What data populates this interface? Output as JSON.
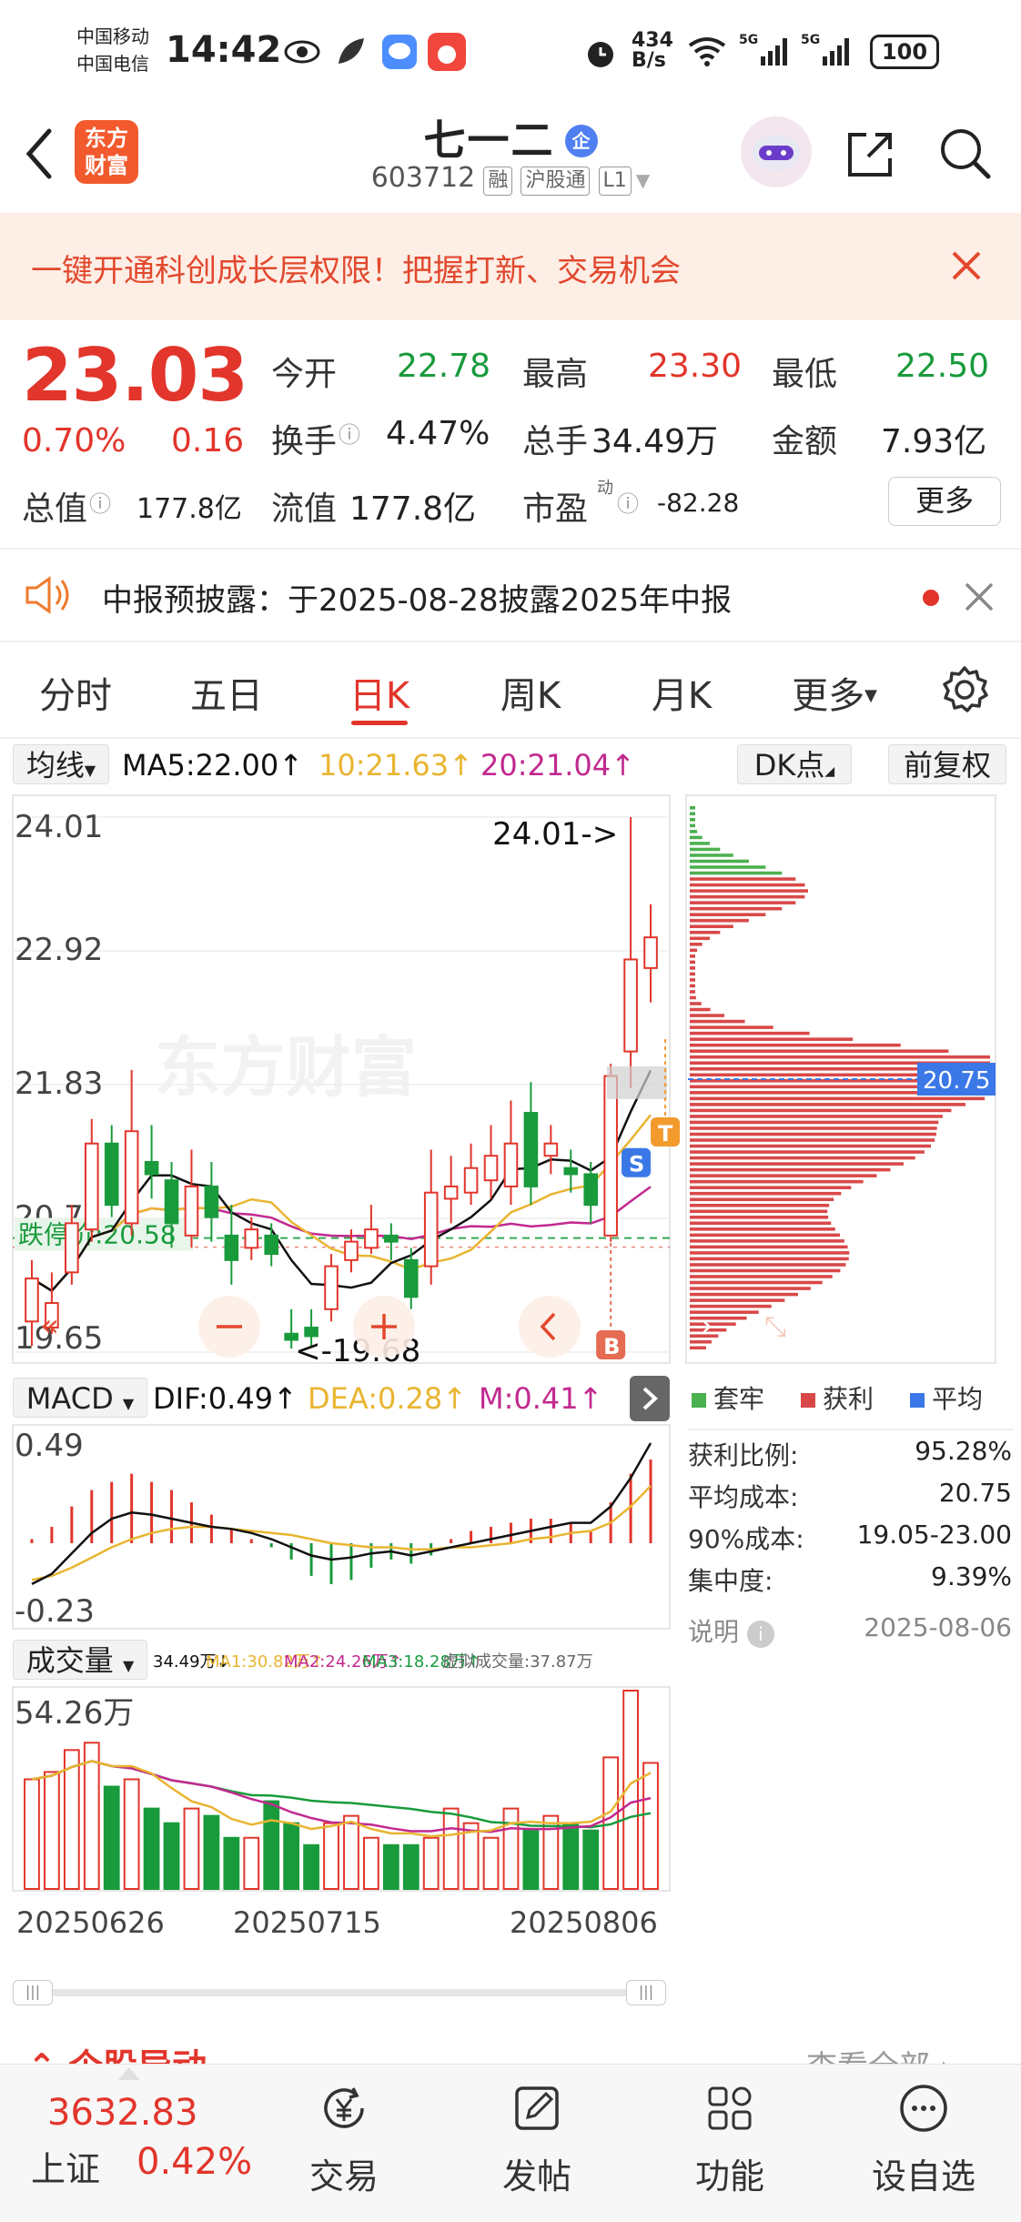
{
  "status_bar": {
    "carrier1": "中国移动",
    "carrier2": "中国电信",
    "time": "14:42",
    "net_speed": "434",
    "net_unit": "B/s",
    "battery": "100"
  },
  "header": {
    "title": "七一二",
    "badge": "企",
    "code": "603712",
    "tags": [
      "融",
      "沪股通",
      "L1"
    ],
    "logo_line1": "东方",
    "logo_line2": "财富"
  },
  "banner": {
    "text": "一键开通科创成长层权限！把握打新、交易机会"
  },
  "quote": {
    "price": "23.03",
    "change_pct": "0.70%",
    "change": "0.16",
    "open_label": "今开",
    "open": "22.78",
    "high_label": "最高",
    "high": "23.30",
    "low_label": "最低",
    "low": "22.50",
    "turnover_label": "换手",
    "turnover": "4.47%",
    "volume_label": "总手",
    "volume": "34.49万",
    "amount_label": "金额",
    "amount": "7.93亿",
    "mcap_label": "总值",
    "mcap": "177.8亿",
    "float_label": "流值",
    "float_cap": "177.8亿",
    "pe_label": "市盈",
    "pe_sup": "动",
    "pe": "-82.28",
    "more": "更多"
  },
  "notice": {
    "text": "中报预披露：于2025-08-28披露2025年中报"
  },
  "tabs": {
    "items": [
      "分时",
      "五日",
      "日K",
      "周K",
      "月K",
      "更多"
    ],
    "active": 2
  },
  "chart_controls": {
    "ma_select": "均线",
    "ma5": "MA5:22.00↑",
    "ma10": "10:21.63↑",
    "ma20": "20:21.04↑",
    "dk": "DK点",
    "adjust": "前复权"
  },
  "colors": {
    "up": "#e2352b",
    "down": "#199b3c",
    "ma5": "#111111",
    "ma10": "#e9b531",
    "ma20": "#c2298f",
    "avg": "#3b78e7"
  },
  "kline": {
    "y_labels": [
      "24.01",
      "22.92",
      "21.83",
      "20.74",
      "19.65"
    ],
    "max_marker": "24.01->",
    "min_marker": "<-19.68",
    "limit_down": "跌停价:20.58",
    "watermark": "东方财富",
    "signal_s": "S",
    "signal_t": "T",
    "signal_b": "B"
  },
  "chip": {
    "avg_label": "20.75",
    "legend": [
      "套牢",
      "获利",
      "平均"
    ],
    "stats": [
      {
        "label": "获利比例:",
        "value": "95.28%"
      },
      {
        "label": "平均成本:",
        "value": "20.75"
      },
      {
        "label": "90%成本:",
        "value": "19.05-23.00"
      },
      {
        "label": "集中度:",
        "value": "9.39%"
      }
    ],
    "note": "说明",
    "date": "2025-08-06"
  },
  "macd": {
    "select": "MACD",
    "dif": "DIF:0.49↑",
    "dea": "DEA:0.28↑",
    "m": "M:0.41↑",
    "y_top": "0.49",
    "y_bottom": "-0.23"
  },
  "volume": {
    "select": "成交量",
    "v_now": "34.49万↓",
    "ma1": "MA1:30.82万↑",
    "ma2": "MA2:24.26万↑",
    "ma3": "MA3:18.28万↑",
    "virtual": "虚拟成交量:37.87万",
    "y_top": "54.26万",
    "dates": [
      "20250626",
      "20250715",
      "20250806"
    ]
  },
  "peek": {
    "left": "个股异动",
    "right": "查看全部"
  },
  "bottom_nav": {
    "index_value": "3632.83",
    "index_name": "上证",
    "index_pct": "0.42%",
    "items": [
      "交易",
      "发帖",
      "功能",
      "设自选"
    ]
  },
  "chart_data": [
    {
      "type": "candlestick",
      "title": "日K",
      "ylim": [
        19.65,
        24.01
      ],
      "y_ticks": [
        24.01,
        22.92,
        21.83,
        20.74,
        19.65
      ],
      "candles": [
        {
          "o": 19.9,
          "c": 20.25,
          "h": 20.4,
          "l": 19.7
        },
        {
          "o": 19.85,
          "c": 20.05,
          "h": 20.3,
          "l": 19.8
        },
        {
          "o": 20.3,
          "c": 20.7,
          "h": 20.85,
          "l": 20.2
        },
        {
          "o": 20.65,
          "c": 21.35,
          "h": 21.55,
          "l": 20.55
        },
        {
          "o": 21.35,
          "c": 20.85,
          "h": 21.5,
          "l": 20.75
        },
        {
          "o": 20.7,
          "c": 21.45,
          "h": 21.95,
          "l": 20.6
        },
        {
          "o": 21.2,
          "c": 21.1,
          "h": 21.5,
          "l": 20.9
        },
        {
          "o": 21.05,
          "c": 20.7,
          "h": 21.2,
          "l": 20.5
        },
        {
          "o": 20.6,
          "c": 21.0,
          "h": 21.3,
          "l": 20.5
        },
        {
          "o": 21.0,
          "c": 20.75,
          "h": 21.2,
          "l": 20.55
        },
        {
          "o": 20.6,
          "c": 20.4,
          "h": 20.85,
          "l": 20.2
        },
        {
          "o": 20.5,
          "c": 20.65,
          "h": 20.75,
          "l": 20.4
        },
        {
          "o": 20.6,
          "c": 20.45,
          "h": 20.7,
          "l": 20.35
        },
        {
          "o": 19.8,
          "c": 19.75,
          "h": 20.0,
          "l": 19.68
        },
        {
          "o": 19.85,
          "c": 19.78,
          "h": 20.0,
          "l": 19.7
        },
        {
          "o": 20.0,
          "c": 20.35,
          "h": 20.45,
          "l": 19.9
        },
        {
          "o": 20.4,
          "c": 20.55,
          "h": 20.65,
          "l": 20.3
        },
        {
          "o": 20.5,
          "c": 20.65,
          "h": 20.85,
          "l": 20.45
        },
        {
          "o": 20.6,
          "c": 20.55,
          "h": 20.7,
          "l": 20.4
        },
        {
          "o": 20.4,
          "c": 20.1,
          "h": 20.5,
          "l": 20.0
        },
        {
          "o": 20.35,
          "c": 20.95,
          "h": 21.3,
          "l": 20.2
        },
        {
          "o": 20.9,
          "c": 21.0,
          "h": 21.25,
          "l": 20.7
        },
        {
          "o": 20.95,
          "c": 21.15,
          "h": 21.35,
          "l": 20.85
        },
        {
          "o": 21.05,
          "c": 21.25,
          "h": 21.5,
          "l": 20.9
        },
        {
          "o": 21.0,
          "c": 21.35,
          "h": 21.7,
          "l": 20.85
        },
        {
          "o": 21.6,
          "c": 21.0,
          "h": 21.85,
          "l": 20.85
        },
        {
          "o": 21.25,
          "c": 21.35,
          "h": 21.5,
          "l": 21.1
        },
        {
          "o": 21.15,
          "c": 21.1,
          "h": 21.3,
          "l": 20.95
        },
        {
          "o": 21.1,
          "c": 20.85,
          "h": 21.2,
          "l": 20.7
        },
        {
          "o": 20.6,
          "c": 21.9,
          "h": 22.0,
          "l": 20.55
        },
        {
          "o": 22.1,
          "c": 22.85,
          "h": 24.01,
          "l": 21.8
        },
        {
          "o": 22.78,
          "c": 23.03,
          "h": 23.3,
          "l": 22.5
        }
      ],
      "ma5_last": 22.0,
      "ma10_last": 21.63,
      "ma20_last": 21.04,
      "limit_down": 20.58
    },
    {
      "type": "bar",
      "title": "MACD",
      "ylim": [
        -0.23,
        0.49
      ],
      "series": [
        {
          "name": "DIF",
          "last": 0.49
        },
        {
          "name": "DEA",
          "last": 0.28
        },
        {
          "name": "M",
          "values": [
            0.02,
            0.08,
            0.18,
            0.26,
            0.3,
            0.34,
            0.3,
            0.26,
            0.2,
            0.14,
            0.07,
            0.02,
            -0.02,
            -0.08,
            -0.16,
            -0.2,
            -0.18,
            -0.12,
            -0.08,
            -0.1,
            -0.06,
            0.02,
            0.06,
            0.08,
            0.1,
            0.12,
            0.12,
            0.1,
            0.06,
            0.2,
            0.34,
            0.41
          ]
        }
      ]
    },
    {
      "type": "bar",
      "title": "成交量",
      "ylim": [
        0,
        54.26
      ],
      "unit": "万",
      "values": [
        30,
        32,
        38,
        40,
        28,
        30,
        22,
        18,
        22,
        20,
        14,
        14,
        24,
        18,
        12,
        18,
        20,
        14,
        12,
        12,
        14,
        22,
        18,
        14,
        22,
        16,
        20,
        18,
        16,
        36,
        54.26,
        34.49
      ],
      "ma1_last": 30.82,
      "ma2_last": 24.26,
      "ma3_last": 18.28,
      "x_labels": [
        "20250626",
        "20250715",
        "20250806"
      ]
    }
  ]
}
